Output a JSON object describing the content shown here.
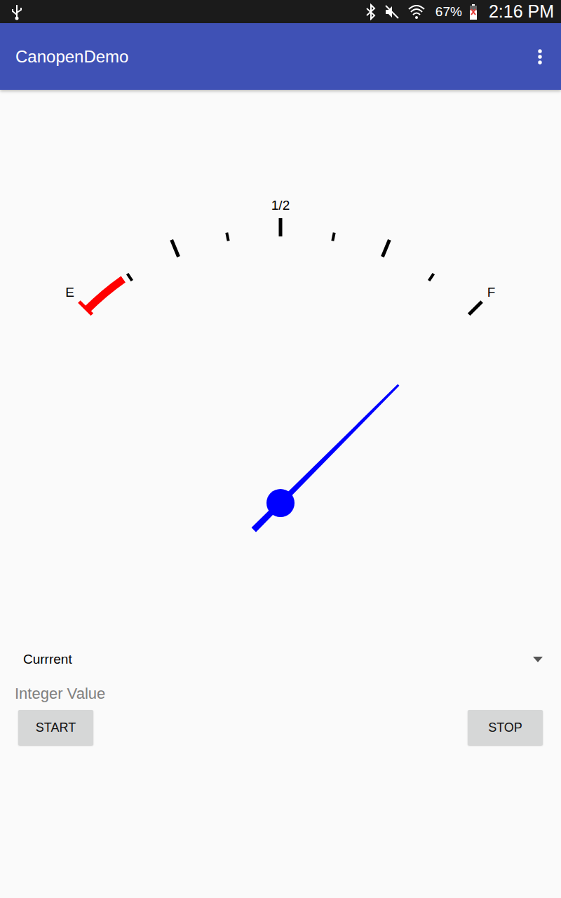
{
  "status_bar": {
    "battery": "67%",
    "battery_level": 0.67,
    "time": "2:16 PM"
  },
  "app_bar": {
    "title": "CanopenDemo"
  },
  "gauge": {
    "labels": [
      "E",
      "1/2",
      "F"
    ],
    "level": 1.0,
    "warning_level": 0.11
  },
  "spinner": {
    "value": "Currrent"
  },
  "input": {
    "placeholder": "Integer Value"
  },
  "buttons": [
    "START",
    "STOP"
  ]
}
